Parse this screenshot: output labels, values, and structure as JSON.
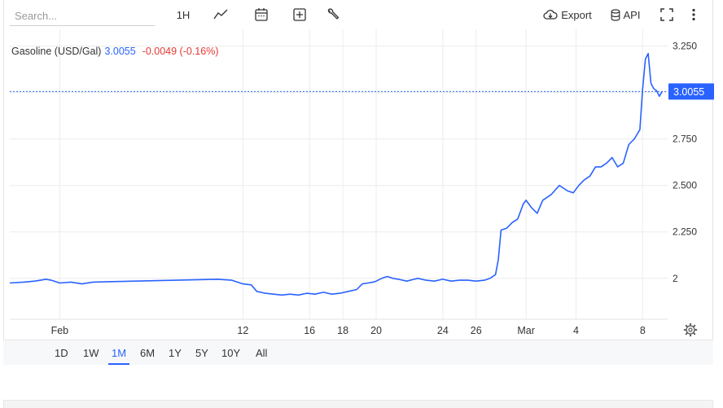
{
  "toolbar": {
    "search_placeholder": "Search...",
    "interval_label": "1H",
    "export_label": "Export",
    "api_label": "API"
  },
  "legend": {
    "symbol": "Gasoline (USD/Gal)",
    "price": "3.0055",
    "change": "-0.0049 (-0.16%)"
  },
  "price_tag": "3.0055",
  "ranges": [
    {
      "label": "1D",
      "active": false
    },
    {
      "label": "1W",
      "active": false
    },
    {
      "label": "1M",
      "active": true
    },
    {
      "label": "6M",
      "active": false
    },
    {
      "label": "1Y",
      "active": false
    },
    {
      "label": "5Y",
      "active": false
    },
    {
      "label": "10Y",
      "active": false
    },
    {
      "label": "All",
      "active": false
    }
  ],
  "colors": {
    "line": "#2962ff",
    "price_tag_bg": "#2962ff",
    "negative": "#e53935",
    "grid": "#ececec"
  },
  "chart_data": {
    "type": "line",
    "title": "",
    "xlabel": "",
    "ylabel": "",
    "ylim": [
      1.78,
      3.34
    ],
    "yticks": [
      {
        "value": 3.25,
        "label": "3.250"
      },
      {
        "value": 3.0,
        "label": ""
      },
      {
        "value": 2.75,
        "label": "2.750"
      },
      {
        "value": 2.5,
        "label": "2.500"
      },
      {
        "value": 2.25,
        "label": "2.250"
      },
      {
        "value": 2.0,
        "label": "2"
      }
    ],
    "xticks": [
      {
        "date": "2025-02-01",
        "label": "Feb"
      },
      {
        "date": "2025-02-12",
        "label": "12"
      },
      {
        "date": "2025-02-16",
        "label": "16"
      },
      {
        "date": "2025-02-18",
        "label": "18"
      },
      {
        "date": "2025-02-20",
        "label": "20"
      },
      {
        "date": "2025-02-24",
        "label": "24"
      },
      {
        "date": "2025-02-26",
        "label": "26"
      },
      {
        "date": "2025-03-01",
        "label": "Mar"
      },
      {
        "date": "2025-03-04",
        "label": "4"
      },
      {
        "date": "2025-03-08",
        "label": "8"
      }
    ],
    "last_value": 3.0055,
    "grid": true,
    "series": [
      {
        "x": [
          "2025-01-29T00:00",
          "2025-01-29T20:00",
          "2025-01-30T12:00",
          "2025-01-31T04:00",
          "2025-01-31T12:00",
          "2025-02-01T00:00",
          "2025-02-01T16:00",
          "2025-02-02T08:00",
          "2025-02-03T00:00",
          "2025-02-10T12:00",
          "2025-02-11T08:00",
          "2025-02-11T16:00",
          "2025-02-12T00:00",
          "2025-02-12T12:00",
          "2025-02-12T20:00",
          "2025-02-13T08:00",
          "2025-02-13T20:00",
          "2025-02-14T08:00",
          "2025-02-14T20:00",
          "2025-02-15T08:00",
          "2025-02-15T20:00",
          "2025-02-16T08:00",
          "2025-02-16T20:00",
          "2025-02-17T08:00",
          "2025-02-17T20:00",
          "2025-02-18T08:00",
          "2025-02-18T20:00",
          "2025-02-19T04:00",
          "2025-02-19T12:00",
          "2025-02-19T20:00",
          "2025-02-20T00:00",
          "2025-02-20T08:00",
          "2025-02-20T16:00",
          "2025-02-21T00:00",
          "2025-02-21T08:00",
          "2025-02-21T20:00",
          "2025-02-22T12:00",
          "2025-02-23T00:00",
          "2025-02-23T12:00",
          "2025-02-24T00:00",
          "2025-02-24T12:00",
          "2025-02-25T00:00",
          "2025-02-25T12:00",
          "2025-02-26T00:00",
          "2025-02-26T12:00",
          "2025-02-26T20:00",
          "2025-02-27T04:00",
          "2025-02-27T08:00",
          "2025-02-27T12:00",
          "2025-02-27T20:00",
          "2025-02-28T04:00",
          "2025-02-28T12:00",
          "2025-02-28T20:00",
          "2025-03-01T00:00",
          "2025-03-01T08:00",
          "2025-03-01T16:00",
          "2025-03-02T00:00",
          "2025-03-02T12:00",
          "2025-03-03T00:00",
          "2025-03-03T12:00",
          "2025-03-03T20:00",
          "2025-03-04T04:00",
          "2025-03-04T12:00",
          "2025-03-04T20:00",
          "2025-03-05T04:00",
          "2025-03-05T12:00",
          "2025-03-05T20:00",
          "2025-03-06T04:00",
          "2025-03-06T12:00",
          "2025-03-06T20:00",
          "2025-03-07T04:00",
          "2025-03-07T12:00",
          "2025-03-07T20:00",
          "2025-03-08T00:00",
          "2025-03-08T04:00",
          "2025-03-08T08:00",
          "2025-03-08T12:00",
          "2025-03-08T16:00",
          "2025-03-08T20:00",
          "2025-03-09T00:00",
          "2025-03-09T04:00"
        ],
        "y": [
          1.975,
          1.98,
          1.985,
          1.995,
          1.99,
          1.975,
          1.98,
          1.97,
          1.98,
          1.995,
          1.99,
          1.98,
          1.97,
          1.965,
          1.93,
          1.92,
          1.915,
          1.91,
          1.915,
          1.91,
          1.92,
          1.915,
          1.925,
          1.915,
          1.92,
          1.93,
          1.94,
          1.97,
          1.975,
          1.98,
          1.985,
          2.0,
          2.01,
          2.0,
          1.995,
          1.985,
          2.0,
          1.99,
          1.985,
          1.995,
          1.985,
          1.99,
          1.99,
          1.985,
          1.99,
          2.0,
          2.02,
          2.1,
          2.26,
          2.27,
          2.3,
          2.32,
          2.4,
          2.42,
          2.38,
          2.35,
          2.42,
          2.45,
          2.5,
          2.47,
          2.46,
          2.5,
          2.53,
          2.55,
          2.6,
          2.6,
          2.62,
          2.65,
          2.6,
          2.62,
          2.72,
          2.75,
          2.8,
          3.02,
          3.18,
          3.21,
          3.05,
          3.02,
          3.01,
          2.98,
          3.0055
        ]
      }
    ]
  }
}
